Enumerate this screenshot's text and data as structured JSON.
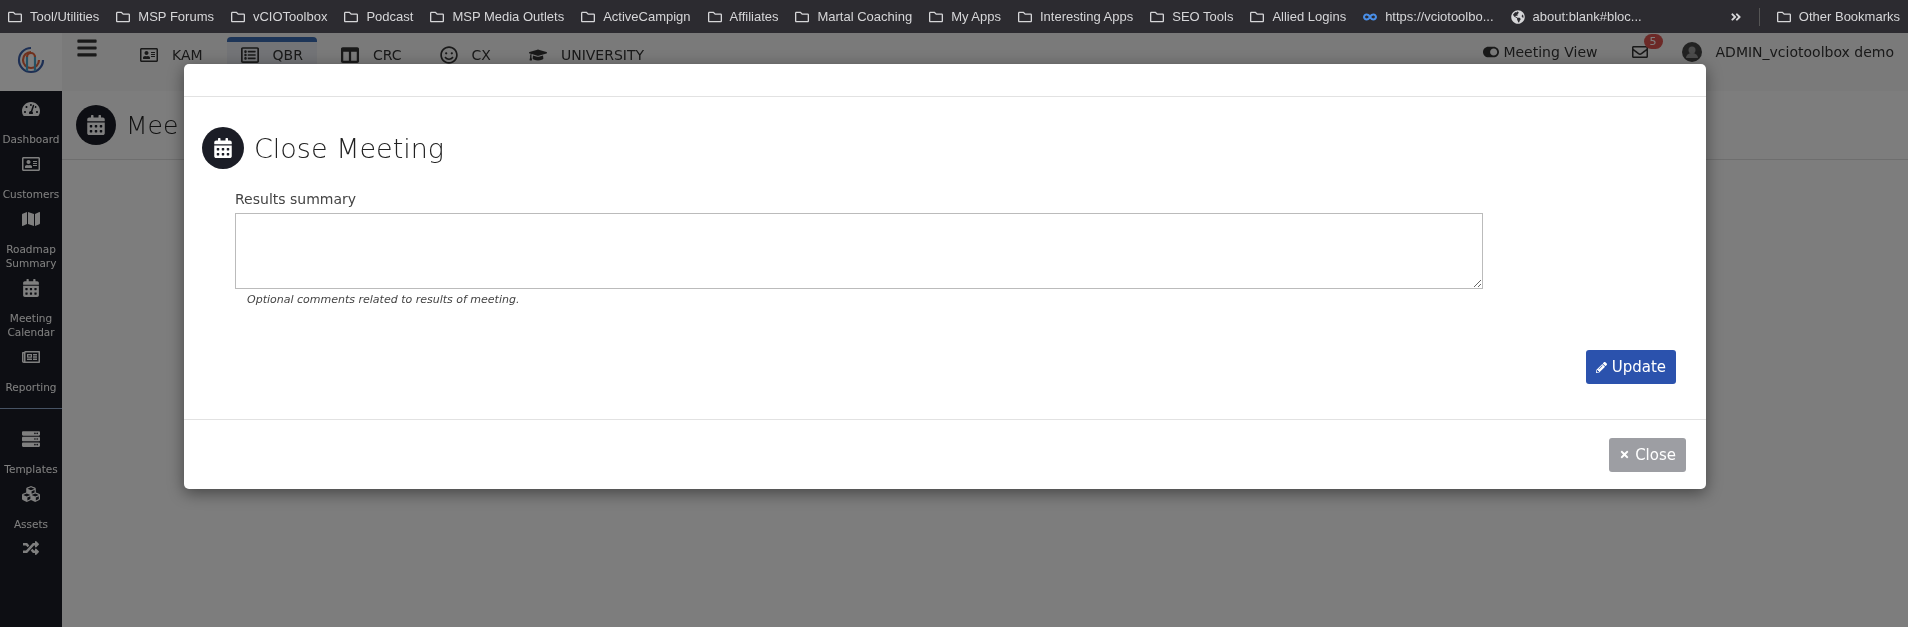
{
  "bookmarks": [
    {
      "kind": "folder",
      "label": "Tool/Utilities"
    },
    {
      "kind": "folder",
      "label": "MSP Forums"
    },
    {
      "kind": "folder",
      "label": "vCIOToolbox"
    },
    {
      "kind": "folder",
      "label": "Podcast"
    },
    {
      "kind": "folder",
      "label": "MSP Media Outlets"
    },
    {
      "kind": "folder",
      "label": "ActiveCampign"
    },
    {
      "kind": "folder",
      "label": "Affiliates"
    },
    {
      "kind": "folder",
      "label": "Martal Coaching"
    },
    {
      "kind": "folder",
      "label": "My Apps"
    },
    {
      "kind": "folder",
      "label": "Interesting Apps"
    },
    {
      "kind": "folder",
      "label": "SEO Tools"
    },
    {
      "kind": "folder",
      "label": "Allied Logins"
    },
    {
      "kind": "link",
      "label": "https://vciotoolbo..."
    },
    {
      "kind": "page",
      "label": "about:blank#bloc..."
    }
  ],
  "other_bookmarks": "Other Bookmarks",
  "header": {
    "tabs": [
      {
        "label": "KAM",
        "selected": false
      },
      {
        "label": "QBR",
        "selected": true
      },
      {
        "label": "CRC",
        "selected": false
      },
      {
        "label": "CX",
        "selected": false
      },
      {
        "label": "UNIVERSITY",
        "selected": false
      }
    ],
    "meeting_view": "Meeting View",
    "mail_badge": "5",
    "user": "ADMIN_vciotoolbox demo"
  },
  "sidebar": {
    "items": [
      {
        "label": "Dashboard"
      },
      {
        "label": "Customers"
      },
      {
        "label": "Roadmap Summary"
      },
      {
        "label": "Meeting Calendar"
      },
      {
        "label": "Reporting"
      },
      {
        "label": "Templates"
      },
      {
        "label": "Assets"
      }
    ]
  },
  "page_title": "Mee",
  "modal": {
    "title": "Close Meeting",
    "field_label": "Results summary",
    "hint": "Optional comments related to results of meeting.",
    "update_button": "Update",
    "close_button": "Close"
  }
}
